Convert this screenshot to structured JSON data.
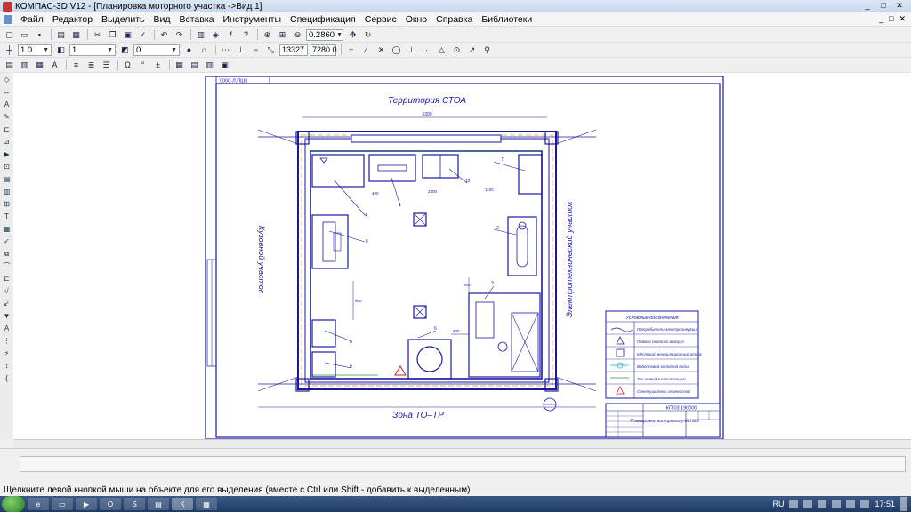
{
  "window": {
    "title": "КОМПАС-3D V12 - [Планировка моторного участка ->Вид 1]",
    "minimize": "_",
    "maximize": "□",
    "close": "✕"
  },
  "menu": [
    "Файл",
    "Редактор",
    "Выделить",
    "Вид",
    "Вставка",
    "Инструменты",
    "Спецификация",
    "Сервис",
    "Окно",
    "Справка",
    "Библиотеки"
  ],
  "toolbar_standard": {
    "zoom_value": "0.2860"
  },
  "toolbar_properties": {
    "line_scale": "1.0",
    "layer": "1",
    "style_value": "0",
    "coord_x": "13327.",
    "coord_y": "7280.0"
  },
  "drawing": {
    "stamp_corner": "0000-Л.ПШК",
    "territory_top": "Территория СТОА",
    "zone_bottom": "Зона ТО–ТР",
    "left_label": "Кузовной участок",
    "right_label": "Электротехнический участок",
    "dim_width": "6300",
    "dims": [
      "2300",
      "1100",
      "400",
      "600",
      "900",
      "900"
    ],
    "callouts": [
      "7",
      "12",
      "1",
      "4",
      "2",
      "5",
      "3",
      "8",
      "9",
      "6"
    ],
    "legend": {
      "title": "Условные обозначения",
      "items": [
        "Потребители электроэнергии",
        "Подвод сжатого воздуха",
        "Местный вентиляционный отсос",
        "Водопровод холодной воды",
        "Зак.отвод в канализацию",
        "Огнетушитель переносной"
      ]
    },
    "title_block": {
      "code": "КП.03.190000",
      "name": "Планировка моторного участка"
    }
  },
  "status_text": "Щелкните левой кнопкой мыши на объекте для его выделения (вместе с Ctrl или Shift - добавить к выделенным)",
  "tray": {
    "language": "RU",
    "clock": "17:51"
  }
}
